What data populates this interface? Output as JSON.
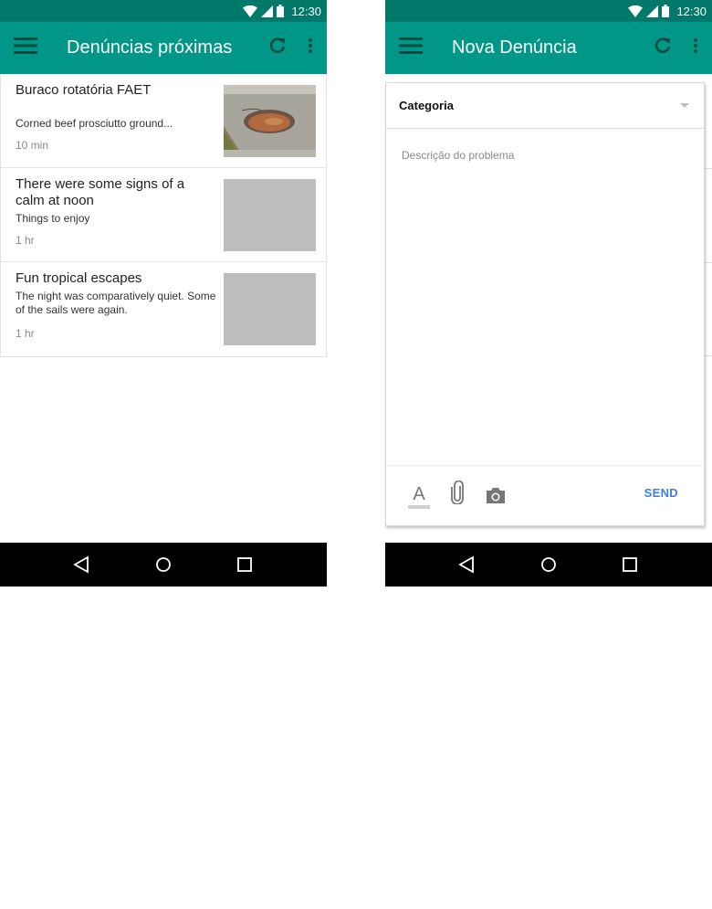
{
  "status_bar": {
    "time": "12:30",
    "wifi_icon": "wifi-icon",
    "signal_icon": "signal-icon",
    "battery_icon": "battery-icon"
  },
  "colors": {
    "status_bar": "#00796b",
    "app_bar": "#009688",
    "send": "#3f7fd8",
    "thumb_placeholder": "#bdbdbd",
    "nav_bar": "#000000"
  },
  "left_screen": {
    "title": "Denúncias próximas",
    "icons": [
      "menu-icon",
      "refresh-icon",
      "more-vert-icon"
    ],
    "items": [
      {
        "title": "Buraco rotatória FAET",
        "subtitle": "Corned beef prosciutto ground...",
        "time": "10 min",
        "image": "pothole-photo"
      },
      {
        "title": "There were some signs of a calm at noon",
        "subtitle": "Things to enjoy",
        "time": "1 hr",
        "image": "placeholder"
      },
      {
        "title": "Fun tropical escapes",
        "subtitle": "The night was comparatively quiet. Some of the sails were again.",
        "time": "1 hr",
        "image": "placeholder"
      }
    ]
  },
  "right_screen": {
    "title": "Nova Denúncia",
    "icons": [
      "menu-icon",
      "refresh-icon",
      "more-vert-icon"
    ],
    "category_label": "Categoria",
    "description_placeholder": "Descrição do problema",
    "toolbar_icons": [
      "text-format-icon",
      "attach-icon",
      "camera-icon"
    ],
    "text_format_glyph": "A",
    "send_label": "SEND"
  },
  "nav_bar": {
    "icons": [
      "back-icon",
      "home-icon",
      "recents-icon"
    ]
  }
}
